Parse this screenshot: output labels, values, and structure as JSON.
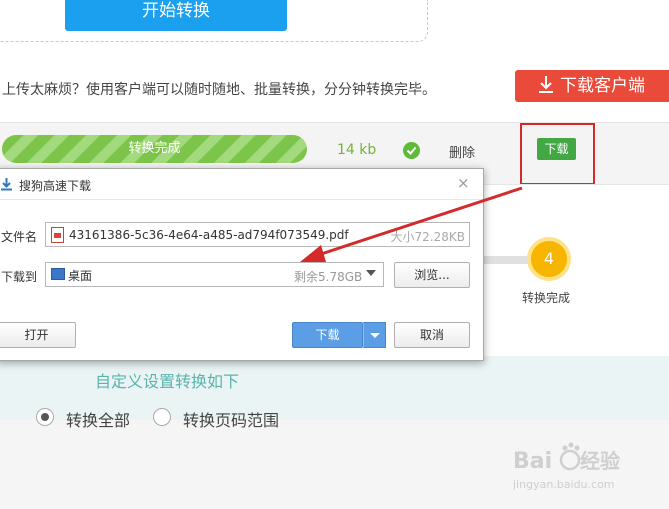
{
  "upload": {
    "start_label": "开始转换"
  },
  "tip": {
    "text": "上传太麻烦？使用客户端可以随时随地、批量转换，分分钟转换完毕。",
    "client_button": "下载客户端"
  },
  "file_row": {
    "progress_label": "转换完成",
    "progress_fraction": 1.0,
    "size": "14 kb",
    "delete_label": "删除",
    "download_label": "下载"
  },
  "step": {
    "number": "4",
    "label": "转换完成"
  },
  "settings": {
    "title": "自定义设置转换如下",
    "options": [
      {
        "label": "转换全部",
        "checked": true
      },
      {
        "label": "转换页码范围",
        "checked": false
      }
    ]
  },
  "dialog": {
    "title": "搜狗高速下载",
    "close_glyph": "×",
    "filename_label": "文件名",
    "filename": "43161386-5c36-4e64-a485-ad794f073549.pdf",
    "filesize": "大小72.28KB",
    "saveto_label": "下载到",
    "path": "桌面",
    "free_space": "剩余5.78GB",
    "browse_label": "浏览...",
    "open_label": "打开",
    "download_label": "下载",
    "cancel_label": "取消"
  },
  "watermark": {
    "logo": "Bai du 经验",
    "sub": "jingyan.baidu.com"
  },
  "colors": {
    "accent_blue": "#1aa0ee",
    "client_red": "#e94a3a",
    "success_green": "#43a744",
    "annotation_red": "#d42a2a",
    "step_yellow": "#f7b500"
  },
  "icons": [
    "download-arrow-icon",
    "check-icon",
    "pdf-file-icon",
    "desktop-icon",
    "close-icon",
    "dropdown-caret-icon"
  ]
}
